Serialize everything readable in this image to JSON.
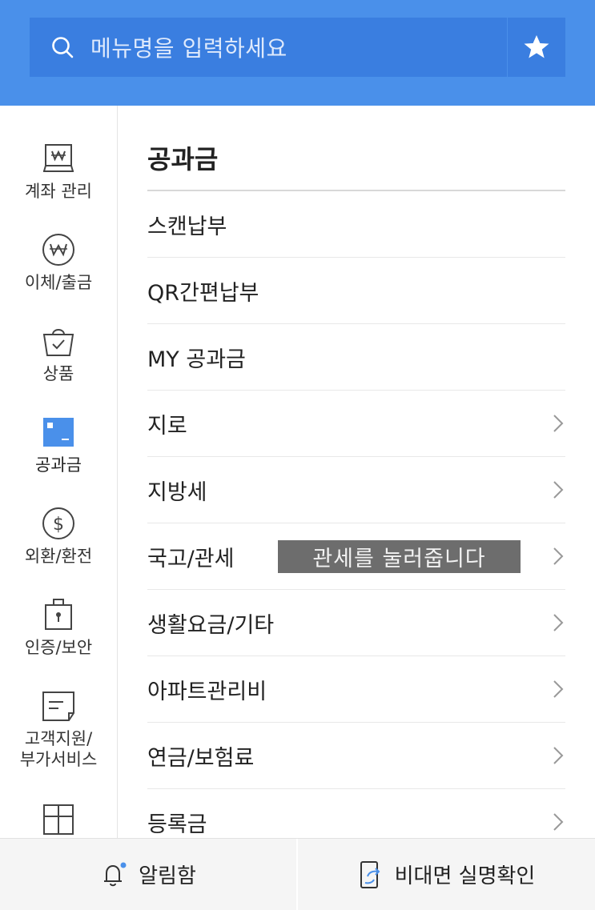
{
  "search": {
    "placeholder": "메뉴명을 입력하세요"
  },
  "sidebar": {
    "items": [
      {
        "label": "계좌 관리",
        "icon": "account-won-icon"
      },
      {
        "label": "이체/출금",
        "icon": "won-coin-icon"
      },
      {
        "label": "상품",
        "icon": "shopping-bag-icon"
      },
      {
        "label": "공과금",
        "icon": "bill-icon",
        "active": true
      },
      {
        "label": "외환/환전",
        "icon": "dollar-coin-icon"
      },
      {
        "label": "인증/보안",
        "icon": "lock-icon"
      },
      {
        "label": "고객지원/\n부가서비스",
        "icon": "support-icon"
      },
      {
        "label": "",
        "icon": "gift-icon"
      }
    ]
  },
  "content": {
    "title": "공과금",
    "menu": [
      {
        "label": "스캔납부",
        "has_chevron": false
      },
      {
        "label": "QR간편납부",
        "has_chevron": false
      },
      {
        "label": "MY 공과금",
        "has_chevron": false
      },
      {
        "label": "지로",
        "has_chevron": true
      },
      {
        "label": "지방세",
        "has_chevron": true
      },
      {
        "label": "국고/관세",
        "has_chevron": true
      },
      {
        "label": "생활요금/기타",
        "has_chevron": true
      },
      {
        "label": "아파트관리비",
        "has_chevron": true
      },
      {
        "label": "연금/보험료",
        "has_chevron": true
      },
      {
        "label": "등록금",
        "has_chevron": true
      }
    ]
  },
  "toast": {
    "text": "관세를 눌러줍니다"
  },
  "bottom": {
    "notifications_label": "알림함",
    "verify_label": "비대면 실명확인"
  },
  "colors": {
    "header": "#4a90ea",
    "search_bg": "#3a7ee0",
    "active_icon": "#4a90ea",
    "toast_bg": "#6d6d6d"
  }
}
